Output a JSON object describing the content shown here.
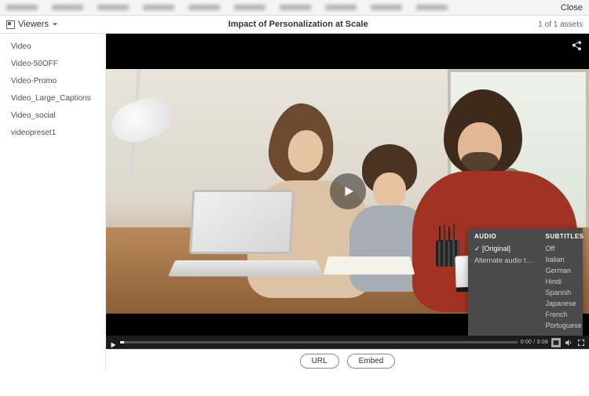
{
  "topbar": {
    "close": "Close"
  },
  "subbar": {
    "viewers_label": "Viewers",
    "title": "Impact of Personalization at Scale",
    "asset_count": "1 of 1 assets"
  },
  "sidebar": {
    "items": [
      {
        "label": "Video"
      },
      {
        "label": "Video-50OFF"
      },
      {
        "label": "Video-Promo"
      },
      {
        "label": "Video_Large_Captions"
      },
      {
        "label": "Video_social"
      },
      {
        "label": "videopreset1"
      }
    ]
  },
  "player": {
    "time": "0:00 / 3:08",
    "popup": {
      "audio_header": "AUDIO",
      "subs_header": "SUBTITLES",
      "audio": [
        {
          "label": "[Original]",
          "selected": true
        },
        {
          "label": "Alternate audio t…",
          "selected": false
        }
      ],
      "subs": [
        {
          "label": "Off"
        },
        {
          "label": "Italian"
        },
        {
          "label": "German"
        },
        {
          "label": "Hindi"
        },
        {
          "label": "Spanish"
        },
        {
          "label": "Japanese"
        },
        {
          "label": "French"
        },
        {
          "label": "Portuguese"
        }
      ]
    }
  },
  "footer": {
    "url": "URL",
    "embed": "Embed"
  }
}
